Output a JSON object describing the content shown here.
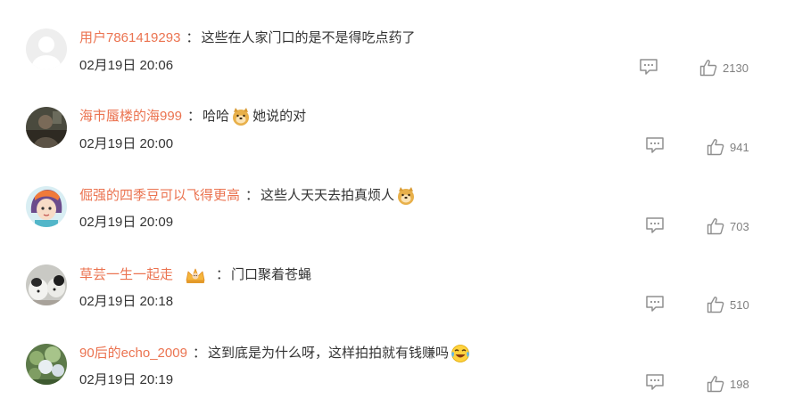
{
  "comments": [
    {
      "username": "用户7861419293",
      "text_before": "这些在人家门口的是不是得吃点药了",
      "text_after": "",
      "emoji": "",
      "badge": false,
      "time": "02月19日 20:06",
      "likes": "2130",
      "avatar_icon": "default-avatar-icon"
    },
    {
      "username": "海市蜃楼的海999",
      "text_before": "哈哈",
      "text_after": "她说的对",
      "emoji": "doge",
      "badge": false,
      "time": "02月19日 20:00",
      "likes": "941",
      "avatar_icon": "photo-avatar-icon"
    },
    {
      "username": "倔强的四季豆可以飞得更高",
      "text_before": "这些人天天去拍真烦人",
      "text_after": "",
      "emoji": "doge",
      "badge": false,
      "time": "02月19日 20:09",
      "likes": "703",
      "avatar_icon": "cartoon-girl-avatar-icon"
    },
    {
      "username": "草芸一生一起走",
      "text_before": "门口聚着苍蝇",
      "text_after": "",
      "emoji": "",
      "badge": true,
      "time": "02月19日 20:18",
      "likes": "510",
      "avatar_icon": "dog-avatar-icon"
    },
    {
      "username": "90后的echo_2009",
      "text_before": "这到底是为什么呀，这样拍拍就有钱赚吗",
      "text_after": "",
      "emoji": "laugh-cry",
      "badge": false,
      "time": "02月19日 20:19",
      "likes": "198",
      "avatar_icon": "flower-avatar-icon"
    }
  ],
  "colors": {
    "username": "#eb7350",
    "text": "#333333",
    "icon": "#8f8f8f"
  }
}
